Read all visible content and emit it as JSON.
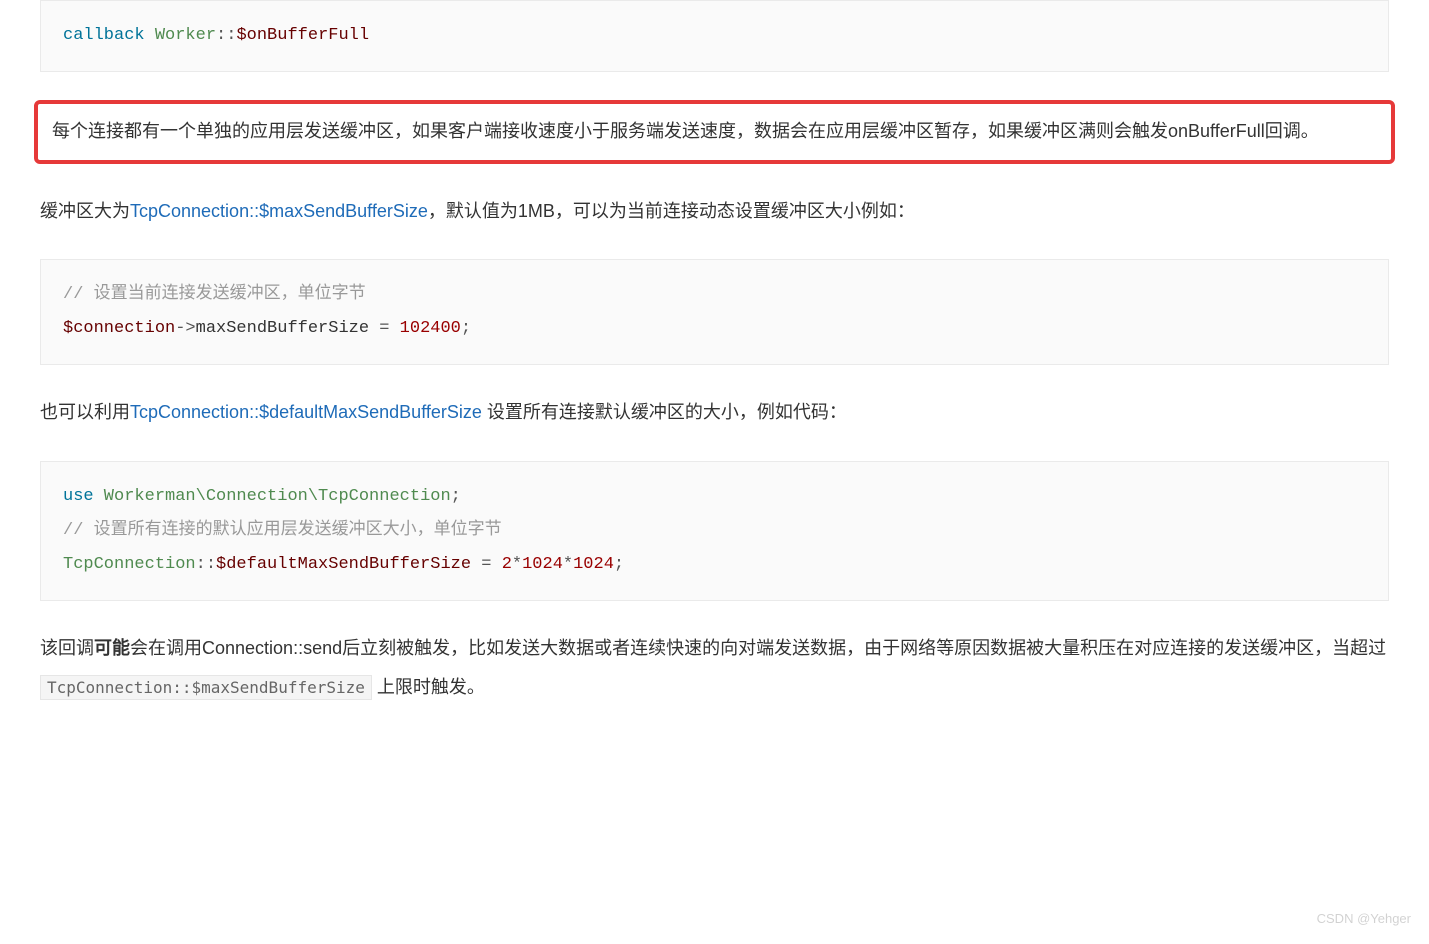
{
  "code1": {
    "kw": "callback",
    "cls": "Worker",
    "sep": "::",
    "var": "$onBufferFull"
  },
  "hl": {
    "text": "每个连接都有一个单独的应用层发送缓冲区，如果客户端接收速度小于服务端发送速度，数据会在应用层缓冲区暂存，如果缓冲区满则会触发onBufferFull回调。"
  },
  "p1": {
    "before": "缓冲区大为",
    "link": "TcpConnection::$maxSendBufferSize",
    "after": "，默认值为1MB，可以为当前连接动态设置缓冲区大小例如："
  },
  "code2": {
    "cmt": "// 设置当前连接发送缓冲区，单位字节",
    "var": "$connection",
    "arrow": "->",
    "prop": "maxSendBufferSize",
    "eq": " = ",
    "num": "102400",
    "semi": ";"
  },
  "p2": {
    "before": "也可以利用",
    "link": "TcpConnection::$defaultMaxSendBufferSize",
    "after": " 设置所有连接默认缓冲区的大小，例如代码："
  },
  "code3": {
    "use": "use",
    "ns": " Workerman\\Connection\\TcpConnection",
    "semi1": ";",
    "cmt": "// 设置所有连接的默认应用层发送缓冲区大小，单位字节",
    "cls": "TcpConnection",
    "sep": "::",
    "var": "$defaultMaxSendBufferSize",
    "eq": " = ",
    "n1": "2",
    "star": "*",
    "n2": "1024",
    "n3": "1024",
    "semi2": ";"
  },
  "p3": {
    "s1": "该回调",
    "bold": "可能",
    "s2": "会在调用Connection::send后立刻被触发，比如发送大数据或者连续快速的向对端发送数据，由于网络等原因数据被大量积压在对应连接的发送缓冲区，当超过 ",
    "inline": "TcpConnection::$maxSendBufferSize",
    "s3": " 上限时触发。"
  },
  "watermark": "CSDN @Yehger"
}
